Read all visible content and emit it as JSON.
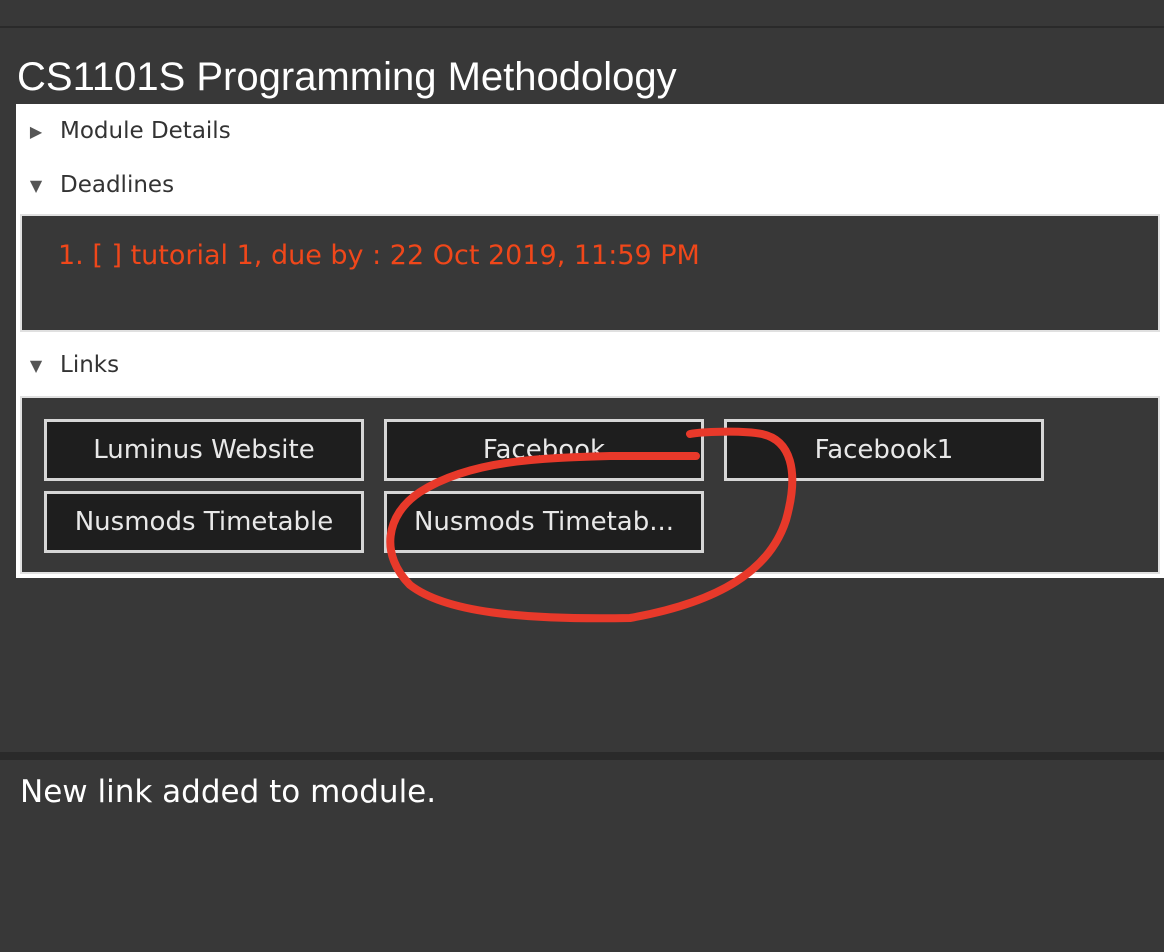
{
  "module": {
    "title": "CS1101S Programming Methodology"
  },
  "sections": {
    "module_details": {
      "label": "Module Details",
      "arrow": "▶",
      "expanded": false
    },
    "deadlines": {
      "label": "Deadlines",
      "arrow": "▼",
      "expanded": true
    },
    "links": {
      "label": "Links",
      "arrow": "▼",
      "expanded": true
    }
  },
  "deadlines": [
    {
      "text": "1. [ ] tutorial 1, due by : 22 Oct 2019, 11:59 PM"
    }
  ],
  "links": [
    {
      "label": "Luminus Website"
    },
    {
      "label": "Facebook"
    },
    {
      "label": "Facebook1"
    },
    {
      "label": "Nusmods Timetable"
    },
    {
      "label": "Nusmods Timetab..."
    }
  ],
  "result": {
    "message": "New link added to module."
  },
  "colors": {
    "background": "#383838",
    "deadline_text": "#f0471a",
    "annotation": "#e8392a"
  }
}
